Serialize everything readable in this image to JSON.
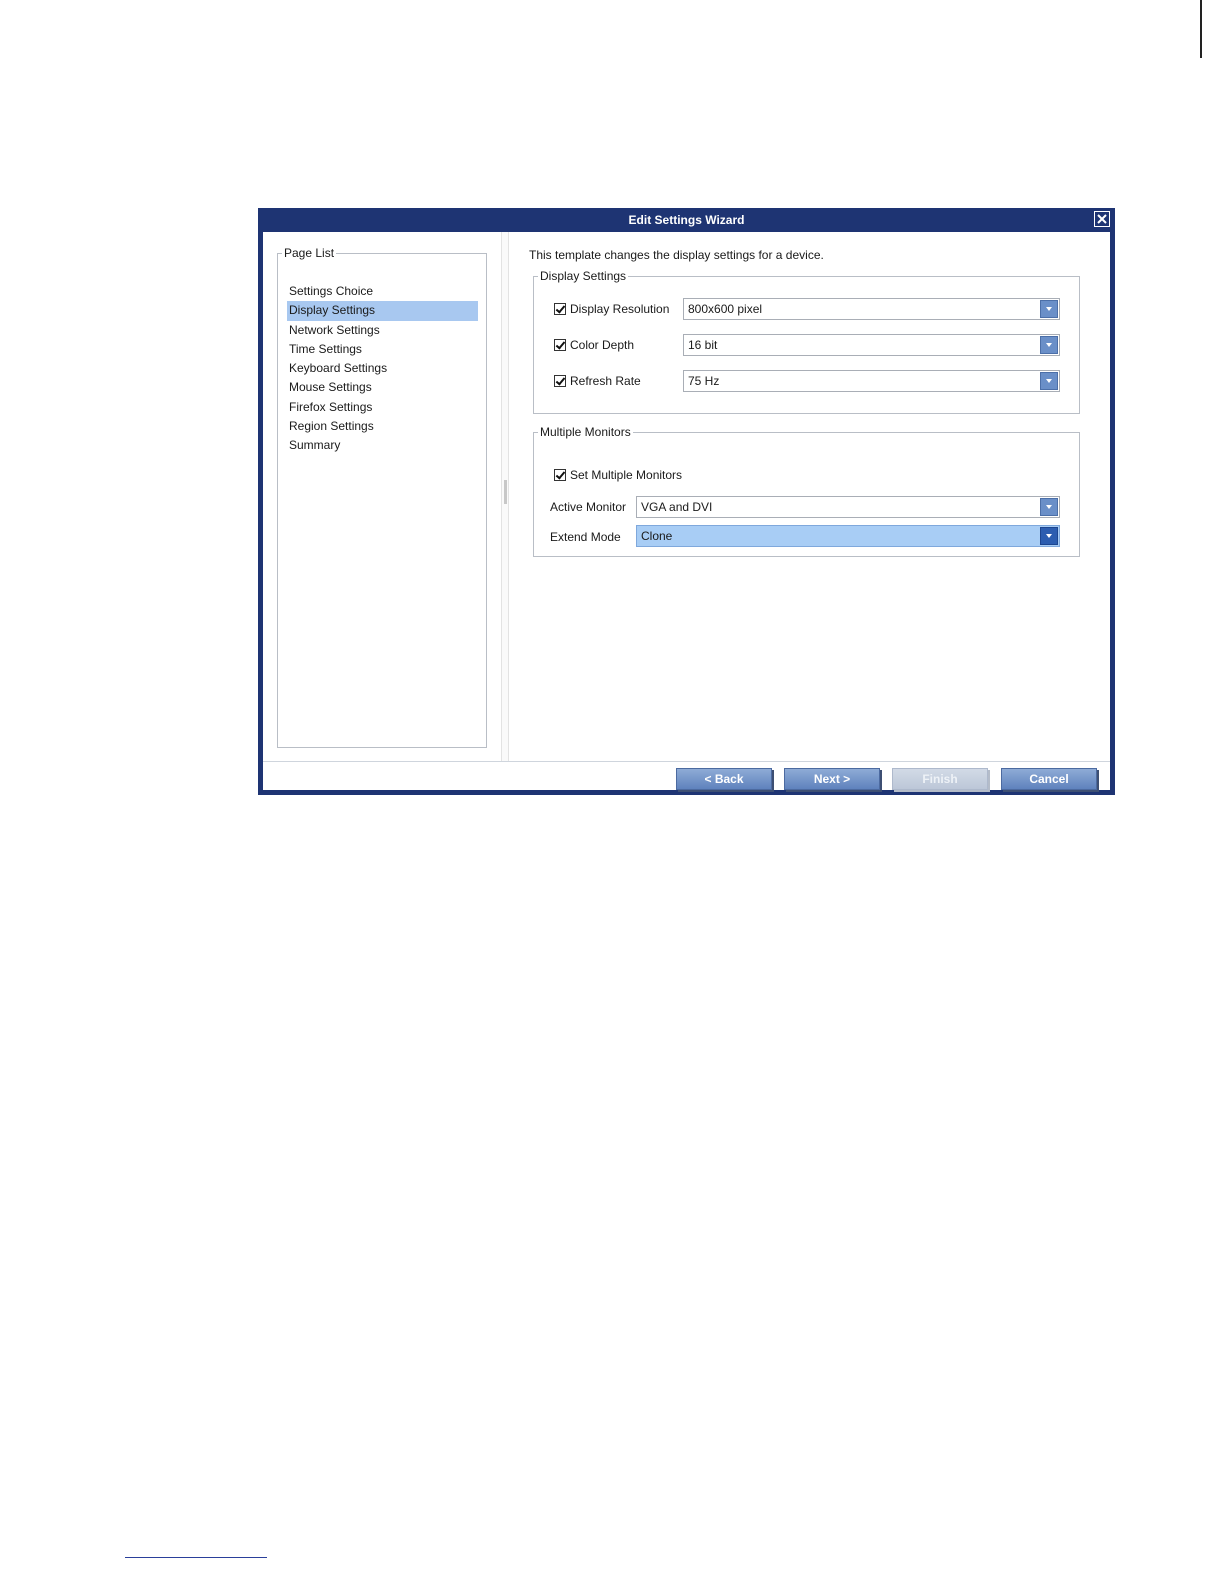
{
  "dialog": {
    "title": "Edit Settings Wizard",
    "close_icon": "close-icon"
  },
  "page_list": {
    "legend": "Page List",
    "items": [
      {
        "label": "Settings Choice",
        "selected": false
      },
      {
        "label": "Display Settings",
        "selected": true
      },
      {
        "label": "Network Settings",
        "selected": false
      },
      {
        "label": "Time Settings",
        "selected": false
      },
      {
        "label": "Keyboard Settings",
        "selected": false
      },
      {
        "label": "Mouse Settings",
        "selected": false
      },
      {
        "label": "Firefox Settings",
        "selected": false
      },
      {
        "label": "Region Settings",
        "selected": false
      },
      {
        "label": "Summary",
        "selected": false
      }
    ]
  },
  "main": {
    "intro": "This template changes the display settings for a device.",
    "display_settings": {
      "legend": "Display Settings",
      "resolution": {
        "label": "Display Resolution",
        "checked": true,
        "value": "800x600 pixel"
      },
      "color_depth": {
        "label": "Color Depth",
        "checked": true,
        "value": "16 bit"
      },
      "refresh_rate": {
        "label": "Refresh Rate",
        "checked": true,
        "value": "75 Hz"
      }
    },
    "multiple_monitors": {
      "legend": "Multiple Monitors",
      "set_multiple": {
        "label": "Set Multiple Monitors",
        "checked": true
      },
      "active_monitor": {
        "label": "Active Monitor",
        "value": "VGA and DVI"
      },
      "extend_mode": {
        "label": "Extend Mode",
        "value": "Clone"
      }
    }
  },
  "buttons": {
    "back": "< Back",
    "next": "Next >",
    "finish": "Finish",
    "cancel": "Cancel"
  },
  "colors": {
    "titlebar": "#1e3473",
    "selection": "#a8c8f0",
    "button": "#6f8fc6"
  }
}
